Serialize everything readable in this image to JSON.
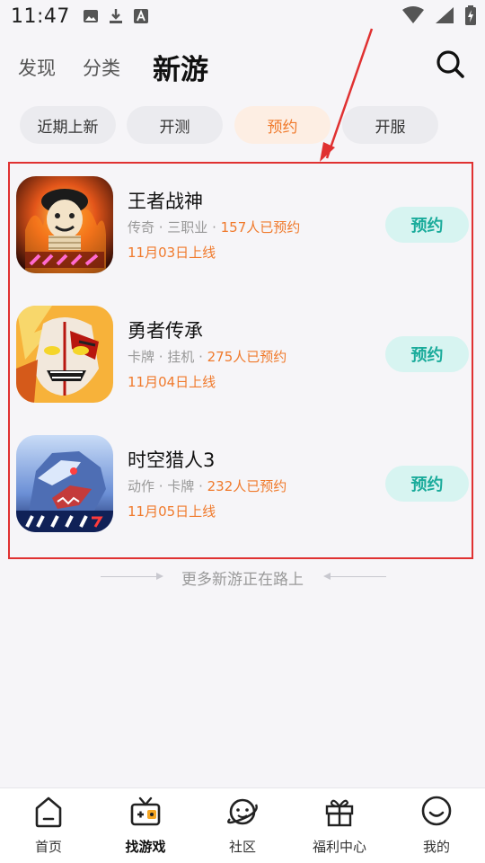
{
  "status_bar": {
    "time": "11:47"
  },
  "top_nav": {
    "tabs": [
      {
        "label": "发现"
      },
      {
        "label": "分类"
      },
      {
        "label": "新游"
      }
    ],
    "active_tab": "新游"
  },
  "sub_tabs": {
    "items": [
      {
        "label": "近期上新"
      },
      {
        "label": "开测"
      },
      {
        "label": "预约"
      },
      {
        "label": "开服"
      }
    ],
    "active": "预约"
  },
  "games": [
    {
      "name": "王者战神",
      "tags": "传奇 · 三职业 · ",
      "reserve_count": "157人已预约",
      "date": "11月03日上线",
      "button": "预约"
    },
    {
      "name": "勇者传承",
      "tags": "卡牌 · 挂机 · ",
      "reserve_count": "275人已预约",
      "date": "11月04日上线",
      "button": "预约"
    },
    {
      "name": "时空猎人3",
      "tags": "动作 · 卡牌 · ",
      "reserve_count": "232人已预约",
      "date": "11月05日上线",
      "button": "预约"
    }
  ],
  "more_text": "更多新游正在路上",
  "bottom_nav": {
    "items": [
      {
        "label": "首页",
        "icon": "home-icon"
      },
      {
        "label": "找游戏",
        "icon": "gamepad-icon"
      },
      {
        "label": "社区",
        "icon": "community-planet-icon"
      },
      {
        "label": "福利中心",
        "icon": "gift-icon"
      },
      {
        "label": "我的",
        "icon": "profile-smile-icon"
      }
    ],
    "active": "找游戏"
  },
  "colors": {
    "accent_orange": "#f07a2c",
    "button_teal": "#1aab9b",
    "button_teal_bg": "#d7f4f1",
    "annotation_red": "#e03131"
  }
}
